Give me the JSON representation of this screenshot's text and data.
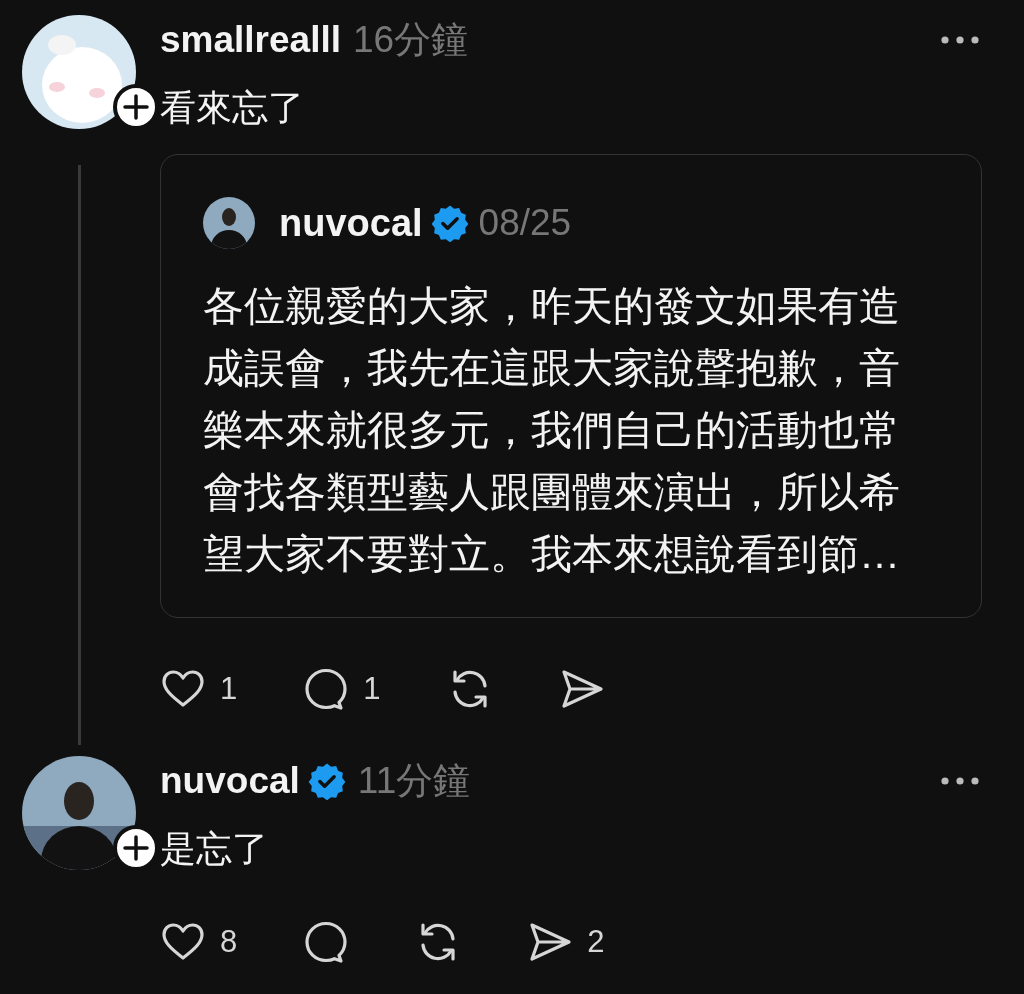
{
  "posts": [
    {
      "author": "smallrealll",
      "verified": false,
      "time": "16分鐘",
      "text": "看來忘了",
      "thread_line": true,
      "quote": {
        "author": "nuvocal",
        "verified": true,
        "time": "08/25",
        "text": "各位親愛的大家，昨天的發文如果有造成誤會，我先在這跟大家說聲抱歉，音樂本來就很多元，我們自己的活動也常會找各類型藝人跟團體來演出，所以希望大家不要對立。我本來想說看到節…"
      },
      "actions": [
        {
          "kind": "like",
          "count": "1"
        },
        {
          "kind": "reply",
          "count": "1"
        },
        {
          "kind": "repost"
        },
        {
          "kind": "share"
        }
      ]
    },
    {
      "author": "nuvocal",
      "verified": true,
      "time": "11分鐘",
      "text": "是忘了",
      "thread_line": false,
      "actions": [
        {
          "kind": "like",
          "count": "8"
        },
        {
          "kind": "reply"
        },
        {
          "kind": "repost"
        },
        {
          "kind": "share",
          "count": "2"
        }
      ]
    }
  ]
}
